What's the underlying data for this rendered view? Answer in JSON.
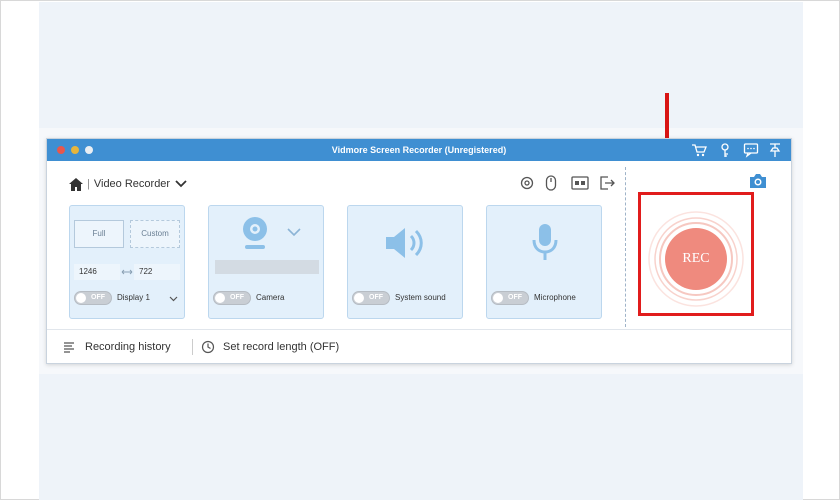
{
  "window": {
    "title": "Vidmore Screen Recorder (Unregistered)",
    "titlebar_icons": [
      "cart-icon",
      "key-icon",
      "feedback-icon",
      "pin-icon"
    ]
  },
  "header": {
    "mode_separator": "|",
    "mode_label": "Video Recorder",
    "tool_icons": [
      "settings-icon",
      "mouse-icon",
      "mp4-format-icon",
      "exit-icon"
    ]
  },
  "display_card": {
    "full_label": "Full",
    "custom_label": "Custom",
    "width": "1246",
    "height": "722",
    "toggle": "OFF",
    "label": "Display 1"
  },
  "camera_card": {
    "toggle": "OFF",
    "label": "Camera",
    "icon": "webcam-icon"
  },
  "sound_card": {
    "toggle": "OFF",
    "label": "System sound",
    "icon": "speaker-icon"
  },
  "mic_card": {
    "toggle": "OFF",
    "label": "Microphone",
    "icon": "microphone-icon"
  },
  "rec": {
    "label": "REC",
    "highlight_color": "#e11c1c",
    "button_color": "#ef8a7e"
  },
  "bottom": {
    "history_label": "Recording history",
    "record_length_label": "Set record length (OFF)"
  },
  "colors": {
    "titlebar": "#3f8fd2",
    "card_bg": "#e3f0fb",
    "annotation_arrow": "#d81414"
  }
}
